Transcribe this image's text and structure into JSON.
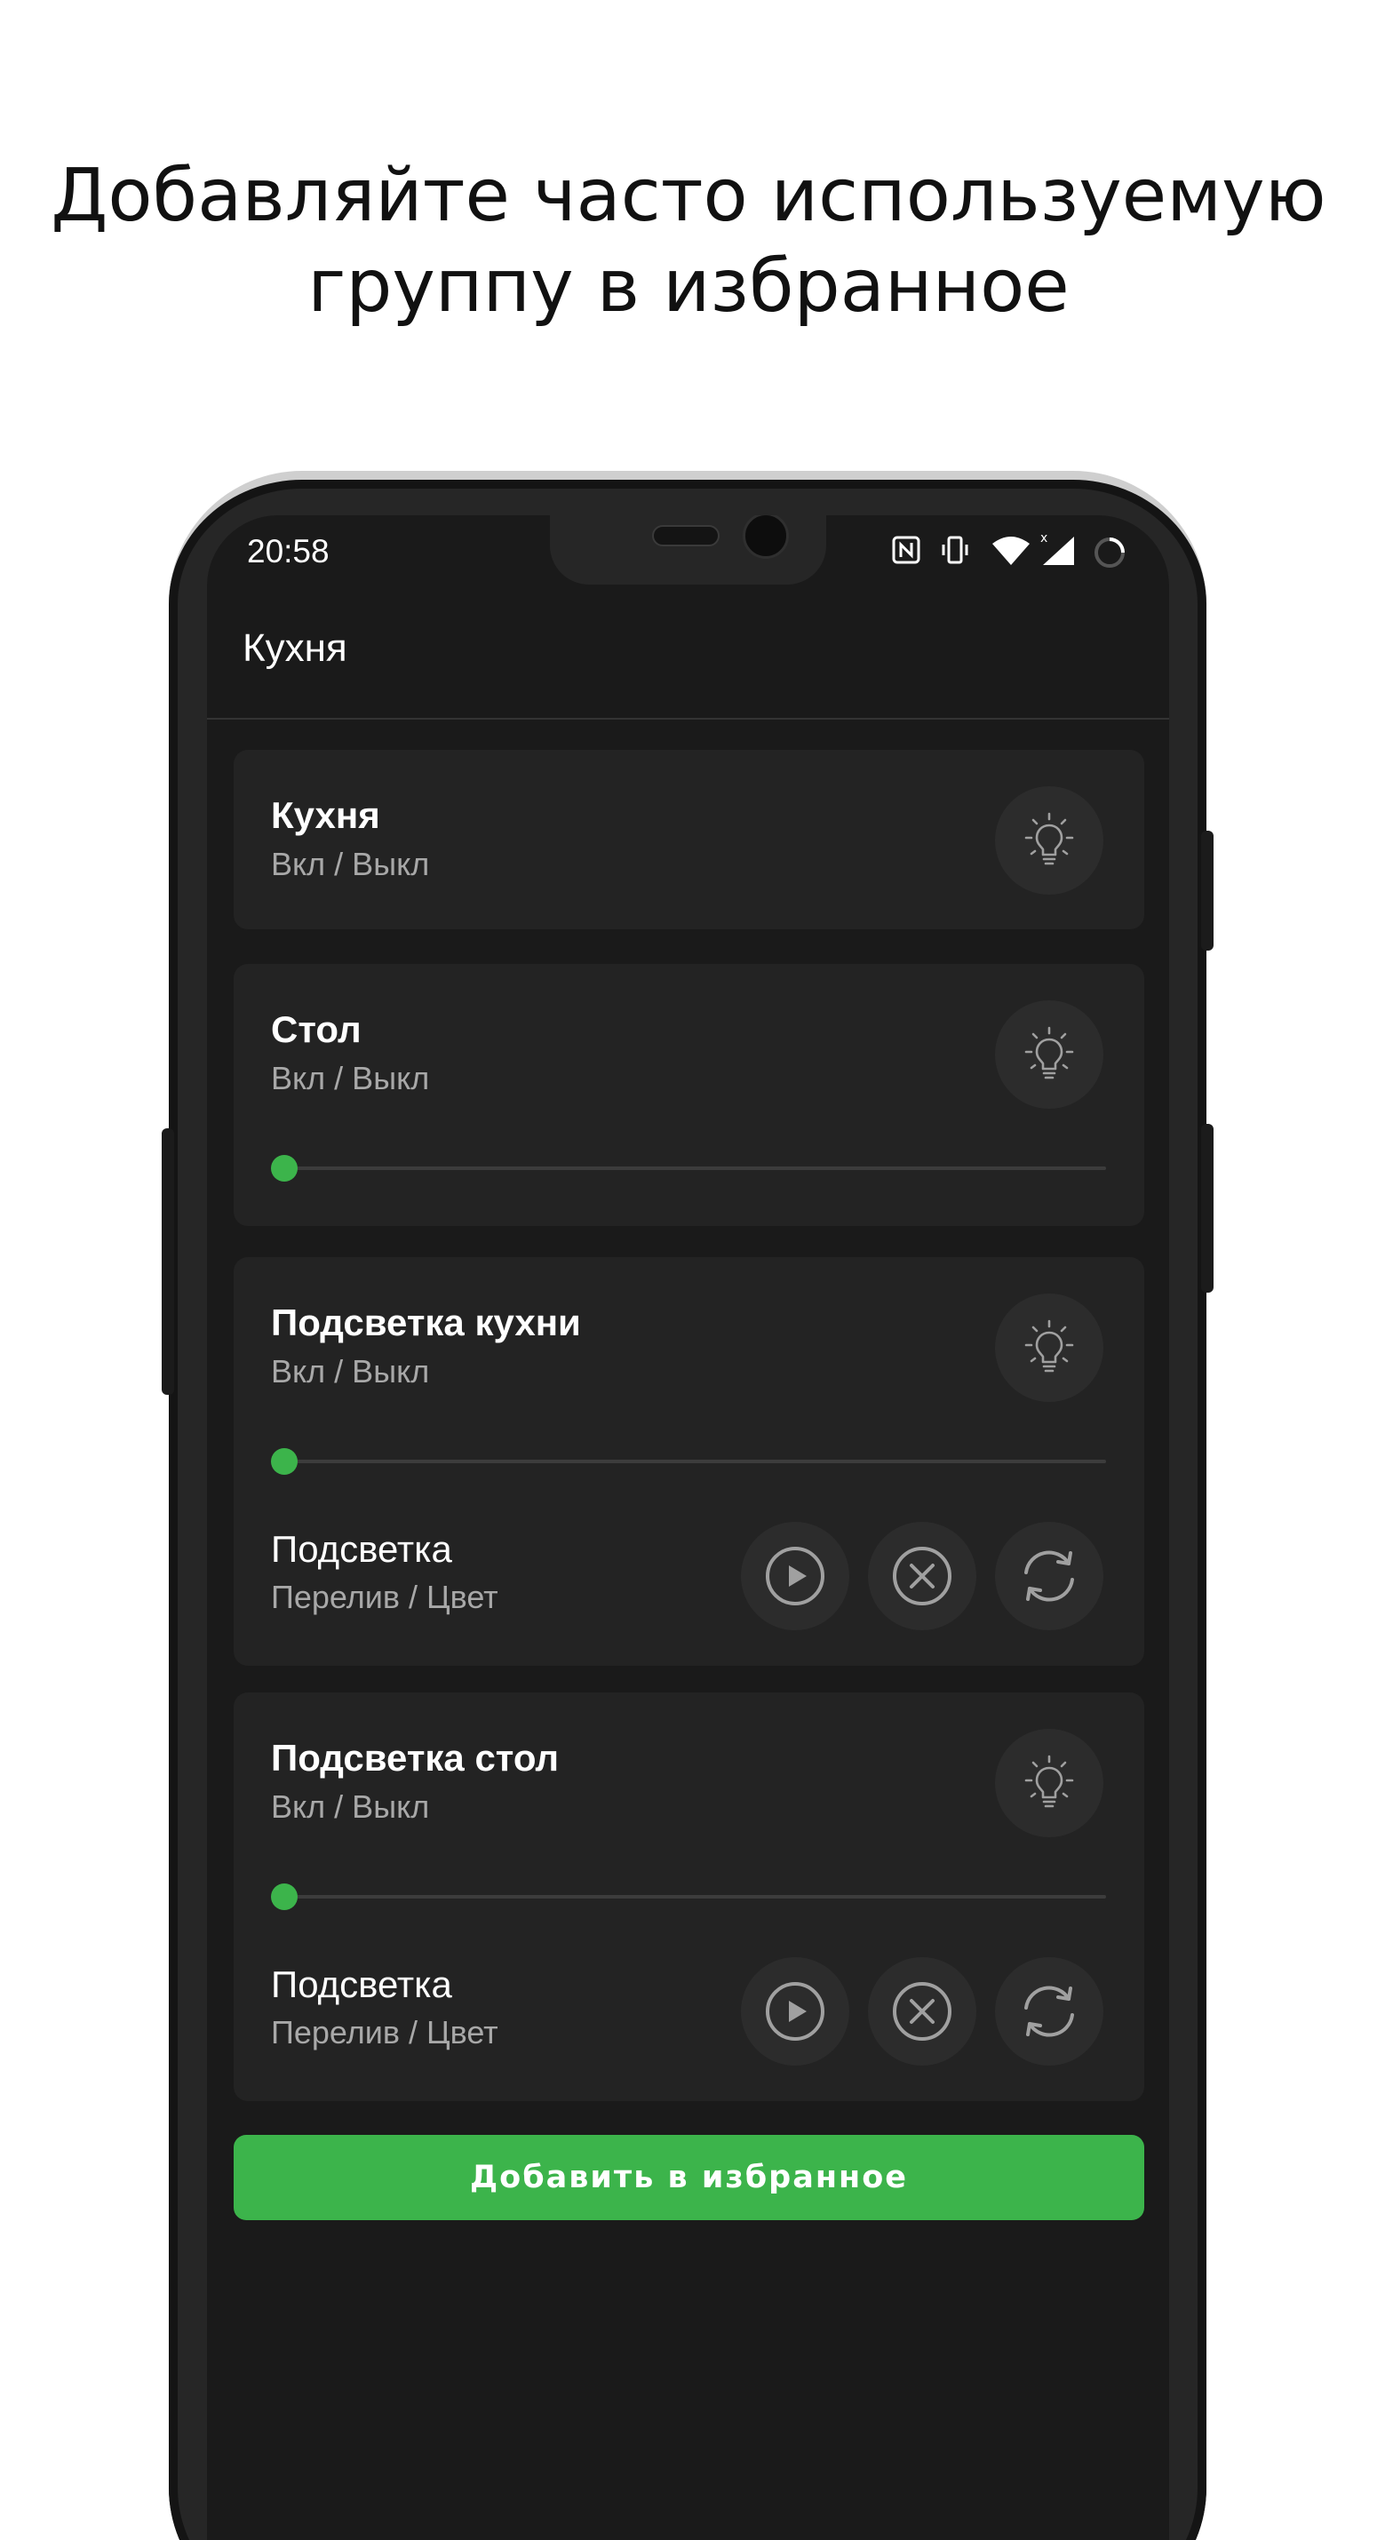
{
  "headline": {
    "line1": "Добавляйте часто используемую",
    "line2": "группу в избранное"
  },
  "status_bar": {
    "time": "20:58",
    "icons": [
      "nfc-icon",
      "vibrate-icon",
      "wifi-icon",
      "signal-icon",
      "battery-icon"
    ]
  },
  "app_bar": {
    "title": "Кухня"
  },
  "cards": [
    {
      "title": "Кухня",
      "subtitle": "Вкл / Выкл",
      "toggle_icon": "light-bulb-icon"
    },
    {
      "title": "Стол",
      "subtitle": "Вкл / Выкл",
      "toggle_icon": "light-bulb-icon",
      "brightness": 0
    },
    {
      "title": "Подсветка кухни",
      "subtitle": "Вкл / Выкл",
      "toggle_icon": "light-bulb-icon",
      "brightness": 0,
      "effect": {
        "title": "Подсветка",
        "subtitle": "Перелив / Цвет",
        "icons": [
          "play-icon",
          "stop-icon",
          "refresh-icon"
        ]
      }
    },
    {
      "title": "Подсветка стол",
      "subtitle": "Вкл / Выкл",
      "toggle_icon": "light-bulb-icon",
      "brightness": 0,
      "effect": {
        "title": "Подсветка",
        "subtitle": "Перелив / Цвет",
        "icons": [
          "play-icon",
          "stop-icon",
          "refresh-icon"
        ]
      }
    }
  ],
  "favorite_button": {
    "label": "Добавить в избранное"
  },
  "colors": {
    "accent": "#3cb44b",
    "screen_bg": "#1a1a1a",
    "card_bg": "#232323",
    "button_bg": "#2c2c2c",
    "icon": "#a0a0a0"
  }
}
